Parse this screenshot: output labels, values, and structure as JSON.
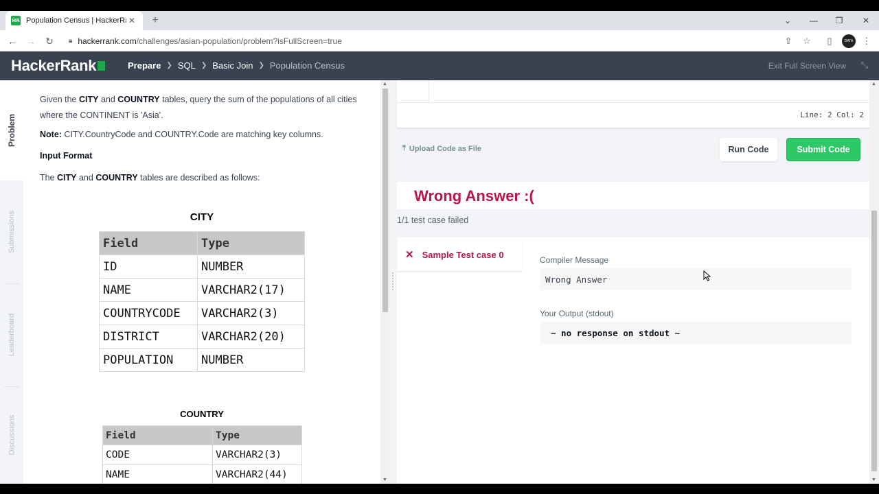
{
  "browser": {
    "tab_title": "Population Census | HackerRank",
    "favicon_text": "HR",
    "url_host": "hackerrank.com",
    "url_path": "/challenges/asian-population/problem?isFullScreen=true",
    "avatar_text": "DATA"
  },
  "header": {
    "logo": "HackerRank",
    "breadcrumbs": [
      "Prepare",
      "SQL",
      "Basic Join",
      "Population Census"
    ],
    "exit_fullscreen": "Exit Full Screen View"
  },
  "leftnav": {
    "items": [
      "Problem",
      "Submissions",
      "Leaderboard",
      "Discussions"
    ]
  },
  "problem": {
    "intro_pre": "Given the ",
    "intro_city": "CITY",
    "intro_and": " and ",
    "intro_country": "COUNTRY",
    "intro_post": " tables, query the sum of the populations of all cities where the CONTINENT is 'Asia'.",
    "note_label": "Note:",
    "note_text": " CITY.CountryCode and COUNTRY.Code are matching key columns.",
    "input_format": "Input Format",
    "desc_pre": "The ",
    "desc_city": "CITY",
    "desc_and": " and ",
    "desc_country": "COUNTRY",
    "desc_post": " tables are described as follows:",
    "city_table": {
      "caption": "CITY",
      "headers": [
        "Field",
        "Type"
      ],
      "rows": [
        [
          "ID",
          "NUMBER"
        ],
        [
          "NAME",
          "VARCHAR2(17)"
        ],
        [
          "COUNTRYCODE",
          "VARCHAR2(3)"
        ],
        [
          "DISTRICT",
          "VARCHAR2(20)"
        ],
        [
          "POPULATION",
          "NUMBER"
        ]
      ]
    },
    "country_table": {
      "caption": "COUNTRY",
      "headers": [
        "Field",
        "Type"
      ],
      "rows": [
        [
          "CODE",
          "VARCHAR2(3)"
        ],
        [
          "NAME",
          "VARCHAR2(44)"
        ]
      ]
    }
  },
  "editor": {
    "line_col": "Line: 2 Col: 2",
    "upload_label": "Upload Code as File",
    "run_label": "Run Code",
    "submit_label": "Submit Code"
  },
  "result": {
    "title": "Wrong Answer :(",
    "summary": "1/1 test case failed",
    "test_case": "Sample Test case 0",
    "compiler_label": "Compiler Message",
    "compiler_value": "Wrong Answer",
    "output_label": "Your Output (stdout)",
    "output_value": "~ no response on stdout ~"
  },
  "colors": {
    "accent_green": "#2ec866",
    "error_red": "#b7164b",
    "header_bg": "#39424e"
  }
}
